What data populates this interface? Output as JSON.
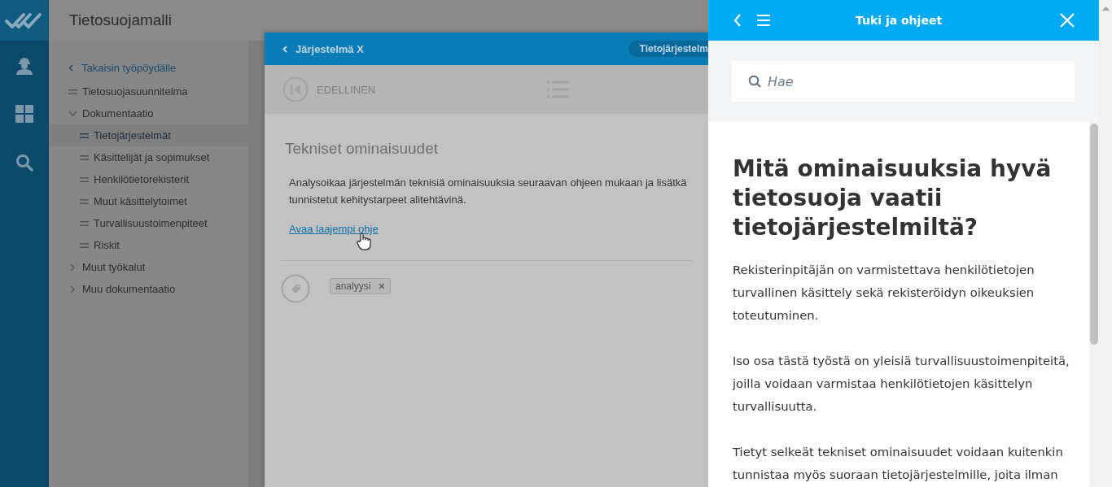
{
  "app": {
    "title": "Tietosuojamalli"
  },
  "rail": {
    "items": [
      {
        "kind": "person",
        "selected": false
      },
      {
        "kind": "grid",
        "selected": false
      },
      {
        "kind": "search",
        "selected": false
      }
    ]
  },
  "nav": {
    "back": "Takaisin työpöydälle",
    "items": [
      {
        "label": "Tietosuojasuunnitelma",
        "kind": "leaf",
        "selected": false
      },
      {
        "label": "Dokumentaatio",
        "kind": "group",
        "expanded": true,
        "children": [
          {
            "label": "Tietojärjestelmät",
            "kind": "leaf",
            "selected": true
          },
          {
            "label": "Käsittelijät ja sopimukset",
            "kind": "leaf",
            "selected": false
          },
          {
            "label": "Henkilötietorekisterit",
            "kind": "leaf",
            "selected": false
          },
          {
            "label": "Muut käsittelytoimet",
            "kind": "leaf",
            "selected": false
          },
          {
            "label": "Turvallisuustoimenpiteet",
            "kind": "leaf",
            "selected": false
          },
          {
            "label": "Riskit",
            "kind": "leaf",
            "selected": false
          }
        ]
      },
      {
        "label": "Muut työkalut",
        "kind": "group",
        "expanded": false
      },
      {
        "label": "Muu dokumentaatio",
        "kind": "group",
        "expanded": false
      }
    ]
  },
  "dialog": {
    "back": "Järjestelmä X",
    "badge": "Tietojärjestelm",
    "previous": "EDELLINEN",
    "heading": "Tekniset ominaisuudet",
    "body_lines": [
      "Analysoikaa järjestelmän teknisiä ominaisuuksia seuraavan ohjeen mukaan ja lisätkä",
      "tunnistetut kehitystarpeet alitehtävinä."
    ],
    "link": "Avaa laajempi ohje",
    "tags": [
      {
        "label": "analyysi"
      }
    ]
  },
  "help": {
    "title": "Tuki ja ohjeet",
    "search": {
      "placeholder": "Hae"
    },
    "article": {
      "heading": "Mitä ominaisuuksia hyvä tietosuoja vaatii tietojärjestelmiltä?",
      "paragraphs": [
        "Rekisterinpitäjän on varmistettava henkilötietojen turvallinen käsittely sekä rekisteröidyn oikeuksien toteutuminen.",
        "Iso osa tästä työstä on yleisiä turvallisuustoimenpiteitä, joilla voidaan varmistaa henkilötietojen käsittelyn turvallisuutta.",
        "Tietyt selkeät tekniset ominaisuudet voidaan kuitenkin tunnistaa myös suoraan tietojärjestelmille, joita ilman"
      ]
    }
  }
}
